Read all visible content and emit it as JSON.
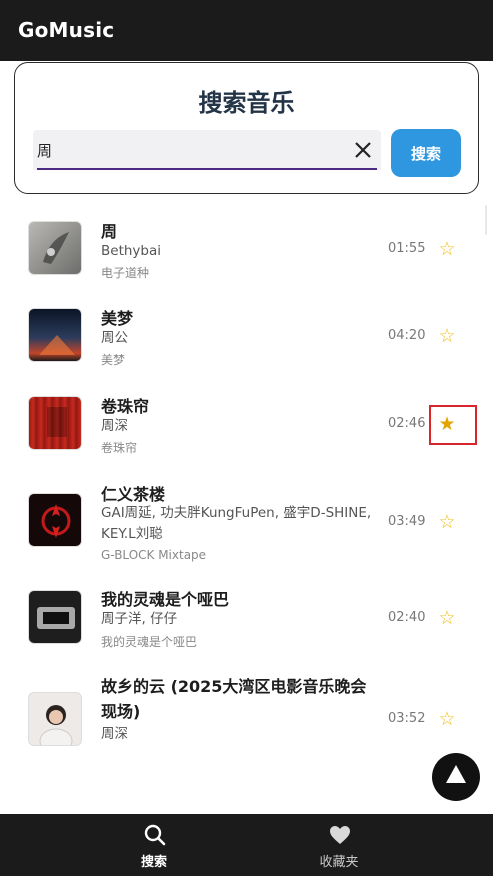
{
  "app": {
    "title": "GoMusic"
  },
  "search": {
    "heading": "搜索音乐",
    "query": "周",
    "button_label": "搜索",
    "clear_icon": "close-icon"
  },
  "results": [
    {
      "title": "周",
      "artist": "Bethybai",
      "album": "电子道种",
      "duration": "01:55",
      "favorited": false,
      "cover_color": "#8a8a88"
    },
    {
      "title": "美梦",
      "artist": "周公",
      "album": "美梦",
      "duration": "04:20",
      "favorited": false,
      "cover_color": "#1c2b44"
    },
    {
      "title": "卷珠帘",
      "artist": "周深",
      "album": "卷珠帘",
      "duration": "02:46",
      "favorited": true,
      "cover_color": "#b0231c"
    },
    {
      "title": "仁义茶楼",
      "artist": "GAI周延, 功夫胖KungFuPen, 盛宇D-SHINE, KEY.L刘聪",
      "album": "G-BLOCK Mixtape",
      "duration": "03:49",
      "favorited": false,
      "cover_color": "#140a0a"
    },
    {
      "title": "我的灵魂是个哑巴",
      "artist": "周子洋, 仔仔",
      "album": "我的灵魂是个哑巴",
      "duration": "02:40",
      "favorited": false,
      "cover_color": "#232323"
    },
    {
      "title": "故乡的云 (2025大湾区电影音乐晚会现场)",
      "artist": "周深",
      "album": "",
      "duration": "03:52",
      "favorited": false,
      "cover_color": "#e6e2e0"
    }
  ],
  "nav": {
    "search_label": "搜索",
    "favorites_label": "收藏夹",
    "search_icon": "search-icon",
    "favorites_icon": "heart-icon"
  },
  "colors": {
    "appbar": "#1b1b1b",
    "accent": "#2e97df",
    "star": "#f0c020",
    "heading": "#243447"
  }
}
